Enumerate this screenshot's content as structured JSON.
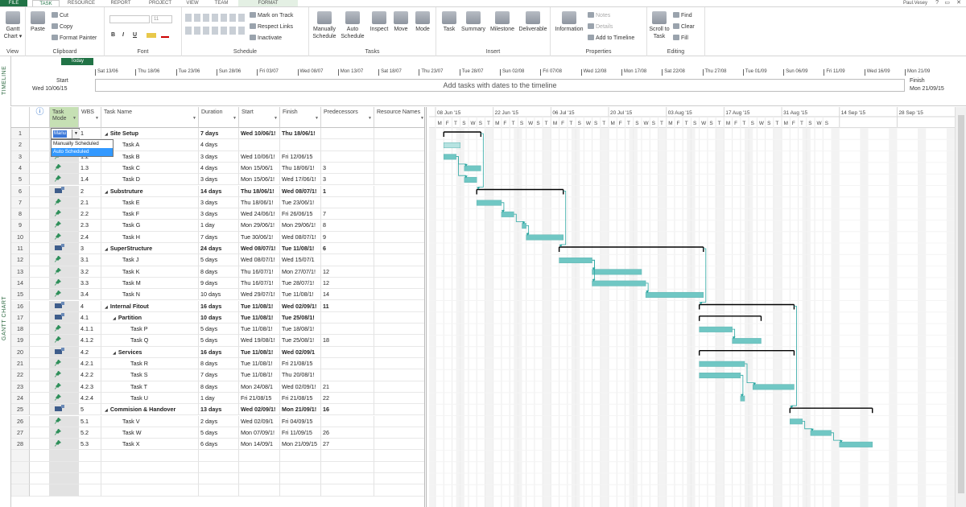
{
  "tabs": [
    "FILE",
    "TASK",
    "RESOURCE",
    "REPORT",
    "PROJECT",
    "VIEW",
    "TEAM",
    "FORMAT"
  ],
  "user": "Paul.Vesey",
  "window_controls": [
    "?",
    "▭",
    "✕"
  ],
  "ribbon": {
    "view": {
      "gantt_line1": "Gantt",
      "gantt_line2": "Chart ▾",
      "label": "View"
    },
    "clipboard": {
      "paste": "Paste",
      "cut": "Cut",
      "copy": "Copy",
      "format_painter": "Format Painter",
      "label": "Clipboard"
    },
    "font": {
      "name": "",
      "size": "11",
      "bold": "B",
      "italic": "I",
      "underline": "U",
      "label": "Font"
    },
    "schedule": {
      "mark_on_track": "Mark on Track",
      "respect_links": "Respect Links",
      "inactivate": "Inactivate",
      "label": "Schedule"
    },
    "tasks": {
      "manually_schedule": "Manually Schedule",
      "auto_schedule": "Auto Schedule",
      "inspect": "Inspect",
      "move": "Move",
      "mode": "Mode",
      "label": "Tasks"
    },
    "insert": {
      "task": "Task",
      "summary": "Summary",
      "milestone": "Milestone",
      "deliverable": "Deliverable",
      "label": "Insert"
    },
    "properties": {
      "information": "Information",
      "notes": "Notes",
      "details": "Details",
      "add_to_timeline": "Add to Timeline",
      "label": "Properties"
    },
    "editing": {
      "scroll_to_task": "Scroll to Task",
      "find": "Find",
      "clear": "Clear",
      "fill": "Fill",
      "label": "Editing"
    }
  },
  "timeline": {
    "side_label": "TIMELINE",
    "today": "Today",
    "start_label": "Start",
    "start_date": "Wed 10/06/15",
    "finish_label": "Finish",
    "finish_date": "Mon 21/09/15",
    "placeholder": "Add tasks with dates to the timeline",
    "ticks": [
      "Sat 13/06",
      "Thu 18/06",
      "Tue 23/06",
      "Sun 28/06",
      "Fri 03/07",
      "Wed 08/07",
      "Mon 13/07",
      "Sat 18/07",
      "Thu 23/07",
      "Tue 28/07",
      "Sun 02/08",
      "Fri 07/08",
      "Wed 12/08",
      "Mon 17/08",
      "Sat 22/08",
      "Thu 27/08",
      "Tue 01/09",
      "Sun 06/09",
      "Fri 11/09",
      "Wed 16/09",
      "Mon 21/09"
    ]
  },
  "grid": {
    "side_label": "GANTT CHART",
    "headers": {
      "info": "ⓘ",
      "mode": "Task Mode",
      "wbs": "WBS",
      "name": "Task Name",
      "duration": "Duration",
      "start": "Start",
      "finish": "Finish",
      "pred": "Predecessors",
      "resource": "Resource Names"
    },
    "dropdown": {
      "value": "Manu",
      "options": [
        "Manually Scheduled",
        "Auto Scheduled"
      ],
      "highlighted": "Auto Scheduled"
    },
    "rows": [
      {
        "id": "1",
        "wbs": "1",
        "name": "Site Setup",
        "summary": true,
        "level": 0,
        "duration": "7 days",
        "start": "Wed 10/06/1!",
        "finish": "Thu 18/06/1!",
        "pred": ""
      },
      {
        "id": "2",
        "wbs": "",
        "name": "Task A",
        "summary": false,
        "level": 1,
        "duration": "4 days",
        "start": "",
        "finish": "",
        "pred": ""
      },
      {
        "id": "3",
        "wbs": "1.2",
        "name": "Task B",
        "summary": false,
        "level": 1,
        "duration": "3 days",
        "start": "Wed 10/06/1!",
        "finish": "Fri 12/06/15",
        "pred": ""
      },
      {
        "id": "4",
        "wbs": "1.3",
        "name": "Task C",
        "summary": false,
        "level": 1,
        "duration": "4 days",
        "start": "Mon 15/06/1",
        "finish": "Thu 18/06/1!",
        "pred": "3"
      },
      {
        "id": "5",
        "wbs": "1.4",
        "name": "Task D",
        "summary": false,
        "level": 1,
        "duration": "3 days",
        "start": "Mon 15/06/1!",
        "finish": "Wed 17/06/1!",
        "pred": "3"
      },
      {
        "id": "6",
        "wbs": "2",
        "name": "Substruture",
        "summary": true,
        "level": 0,
        "duration": "14 days",
        "start": "Thu 18/06/1!",
        "finish": "Wed 08/07/1!",
        "pred": "1"
      },
      {
        "id": "7",
        "wbs": "2.1",
        "name": "Task E",
        "summary": false,
        "level": 1,
        "duration": "3 days",
        "start": "Thu 18/06/1!",
        "finish": "Tue 23/06/1!",
        "pred": ""
      },
      {
        "id": "8",
        "wbs": "2.2",
        "name": "Task F",
        "summary": false,
        "level": 1,
        "duration": "3 days",
        "start": "Wed 24/06/1!",
        "finish": "Fri 26/06/15",
        "pred": "7"
      },
      {
        "id": "9",
        "wbs": "2.3",
        "name": "Task G",
        "summary": false,
        "level": 1,
        "duration": "1 day",
        "start": "Mon 29/06/1!",
        "finish": "Mon 29/06/1!",
        "pred": "8"
      },
      {
        "id": "10",
        "wbs": "2.4",
        "name": "Task H",
        "summary": false,
        "level": 1,
        "duration": "7 days",
        "start": "Tue 30/06/1!",
        "finish": "Wed 08/07/1!",
        "pred": "9"
      },
      {
        "id": "11",
        "wbs": "3",
        "name": "SuperStructure",
        "summary": true,
        "level": 0,
        "duration": "24 days",
        "start": "Wed 08/07/1!",
        "finish": "Tue 11/08/1!",
        "pred": "6"
      },
      {
        "id": "12",
        "wbs": "3.1",
        "name": "Task J",
        "summary": false,
        "level": 1,
        "duration": "5 days",
        "start": "Wed 08/07/1!",
        "finish": "Wed 15/07/1",
        "pred": ""
      },
      {
        "id": "13",
        "wbs": "3.2",
        "name": "Task K",
        "summary": false,
        "level": 1,
        "duration": "8 days",
        "start": "Thu 16/07/1!",
        "finish": "Mon 27/07/1!",
        "pred": "12"
      },
      {
        "id": "14",
        "wbs": "3.3",
        "name": "Task M",
        "summary": false,
        "level": 1,
        "duration": "9 days",
        "start": "Thu 16/07/1!",
        "finish": "Tue 28/07/1!",
        "pred": "12"
      },
      {
        "id": "15",
        "wbs": "3.4",
        "name": "Task N",
        "summary": false,
        "level": 1,
        "duration": "10 days",
        "start": "Wed 29/07/1!",
        "finish": "Tue 11/08/1!",
        "pred": "14"
      },
      {
        "id": "16",
        "wbs": "4",
        "name": "Internal Fitout",
        "summary": true,
        "level": 0,
        "duration": "16 days",
        "start": "Tue 11/08/1!",
        "finish": "Wed 02/09/1!",
        "pred": "11"
      },
      {
        "id": "17",
        "wbs": "4.1",
        "name": "Partition",
        "summary": true,
        "level": 1,
        "duration": "10 days",
        "start": "Tue 11/08/1!",
        "finish": "Tue 25/08/1!",
        "pred": ""
      },
      {
        "id": "18",
        "wbs": "4.1.1",
        "name": "Task P",
        "summary": false,
        "level": 2,
        "duration": "5 days",
        "start": "Tue 11/08/1!",
        "finish": "Tue 18/08/1!",
        "pred": ""
      },
      {
        "id": "19",
        "wbs": "4.1.2",
        "name": "Task Q",
        "summary": false,
        "level": 2,
        "duration": "5 days",
        "start": "Wed 19/08/1!",
        "finish": "Tue 25/08/1!",
        "pred": "18"
      },
      {
        "id": "20",
        "wbs": "4.2",
        "name": "Services",
        "summary": true,
        "level": 1,
        "duration": "16 days",
        "start": "Tue 11/08/1!",
        "finish": "Wed 02/09/1",
        "pred": ""
      },
      {
        "id": "21",
        "wbs": "4.2.1",
        "name": "Task R",
        "summary": false,
        "level": 2,
        "duration": "8 days",
        "start": "Tue 11/08/1!",
        "finish": "Fri 21/08/15",
        "pred": ""
      },
      {
        "id": "22",
        "wbs": "4.2.2",
        "name": "Task S",
        "summary": false,
        "level": 2,
        "duration": "7 days",
        "start": "Tue 11/08/1!",
        "finish": "Thu 20/08/1!",
        "pred": ""
      },
      {
        "id": "23",
        "wbs": "4.2.3",
        "name": "Task T",
        "summary": false,
        "level": 2,
        "duration": "8 days",
        "start": "Mon 24/08/1",
        "finish": "Wed 02/09/1!",
        "pred": "21"
      },
      {
        "id": "24",
        "wbs": "4.2.4",
        "name": "Task U",
        "summary": false,
        "level": 2,
        "duration": "1 day",
        "start": "Fri 21/08/15",
        "finish": "Fri 21/08/15",
        "pred": "22"
      },
      {
        "id": "25",
        "wbs": "5",
        "name": "Commision & Handover",
        "summary": true,
        "level": 0,
        "duration": "13 days",
        "start": "Wed 02/09/1!",
        "finish": "Mon 21/09/1!",
        "pred": "16"
      },
      {
        "id": "26",
        "wbs": "5.1",
        "name": "Task V",
        "summary": false,
        "level": 1,
        "duration": "2 days",
        "start": "Wed 02/09/1",
        "finish": "Fri 04/09/15",
        "pred": ""
      },
      {
        "id": "27",
        "wbs": "5.2",
        "name": "Task W",
        "summary": false,
        "level": 1,
        "duration": "5 days",
        "start": "Mon 07/09/1!",
        "finish": "Fri 11/09/15",
        "pred": "26"
      },
      {
        "id": "28",
        "wbs": "5.3",
        "name": "Task X",
        "summary": false,
        "level": 1,
        "duration": "6 days",
        "start": "Mon 14/09/1",
        "finish": "Mon 21/09/15",
        "pred": "27"
      }
    ]
  },
  "gantt": {
    "weeks": [
      "08 Jun '15",
      "22 Jun '15",
      "06 Jul '15",
      "20 Jul '15",
      "03 Aug '15",
      "17 Aug '15",
      "31 Aug '15",
      "14 Sep '15",
      "28 Sep '15"
    ],
    "day_letters": [
      "M",
      "F",
      "T",
      "S",
      "W",
      "S",
      "T"
    ],
    "colors": {
      "bar": "#70c7c4",
      "bar_border": "#5fb4b1",
      "summary": "#000000",
      "link": "#2aa6a1"
    }
  }
}
